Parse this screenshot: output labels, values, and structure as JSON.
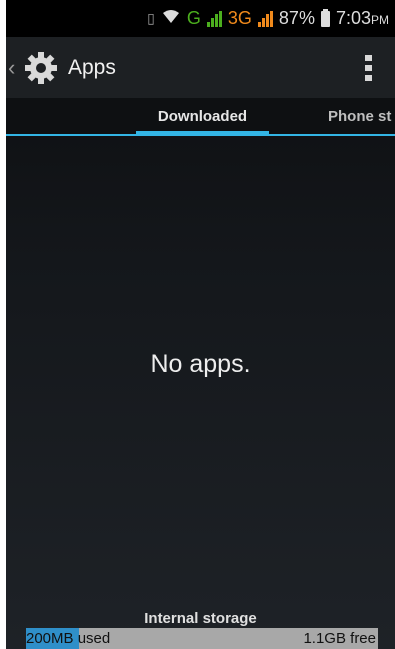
{
  "status_bar": {
    "network_g": "G",
    "network_3g": "3G",
    "battery": "87%",
    "time": "7:03",
    "ampm": "PM",
    "icons": [
      "sim-icon",
      "wifi-icon",
      "signal-icon",
      "signal-icon",
      "battery-icon"
    ]
  },
  "action_bar": {
    "title": "Apps",
    "icons": [
      "back-caret-icon",
      "settings-gear-icon",
      "overflow-menu-icon"
    ]
  },
  "tabs": [
    {
      "label": "Downloaded",
      "selected": true
    },
    {
      "label": "Phone st",
      "selected": false
    }
  ],
  "main": {
    "empty_message": "No apps."
  },
  "storage": {
    "label": "Internal storage",
    "used": "200MB",
    "used_suffix": " used",
    "free": "1.1GB free",
    "used_fraction": 0.15
  },
  "colors": {
    "accent": "#33b5e5",
    "storage_fill": "#2f8fc9",
    "network_green": "#4caf1e",
    "network_orange": "#f08a1c"
  }
}
